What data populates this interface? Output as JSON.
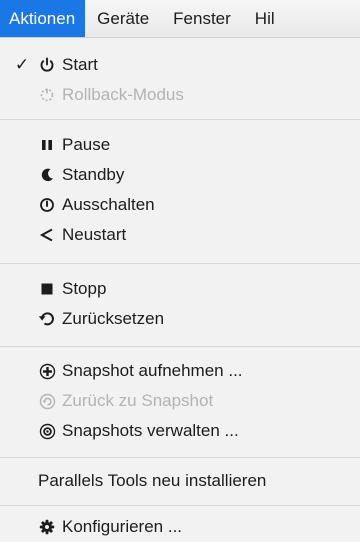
{
  "menubar": {
    "items": [
      "Aktionen",
      "Geräte",
      "Fenster",
      "Hil"
    ]
  },
  "menu": {
    "items": [
      {
        "label": "Start",
        "icon": "power-icon",
        "checked": true,
        "check_mark": "✓",
        "enabled": true
      },
      {
        "label": "Rollback-Modus",
        "icon": "rollback-icon",
        "enabled": false
      },
      {
        "label": "Pause",
        "icon": "pause-icon",
        "enabled": true
      },
      {
        "label": "Standby",
        "icon": "moon-icon",
        "enabled": true
      },
      {
        "label": "Ausschalten",
        "icon": "power-off-icon",
        "enabled": true
      },
      {
        "label": "Neustart",
        "icon": "restart-icon",
        "enabled": true
      },
      {
        "label": "Stopp",
        "icon": "stop-icon",
        "enabled": true
      },
      {
        "label": "Zurücksetzen",
        "icon": "reset-icon",
        "enabled": true
      },
      {
        "label": "Snapshot aufnehmen ...",
        "icon": "snapshot-take-icon",
        "enabled": true
      },
      {
        "label": "Zurück zu Snapshot",
        "icon": "snapshot-revert-icon",
        "enabled": false
      },
      {
        "label": "Snapshots verwalten ...",
        "icon": "snapshot-manage-icon",
        "enabled": true
      },
      {
        "label": "Parallels Tools neu installieren",
        "enabled": true
      },
      {
        "label": "Konfigurieren ...",
        "icon": "gear-icon",
        "enabled": true
      }
    ]
  },
  "colors": {
    "menubar_highlight": "#1b76e6",
    "disabled_text": "#b3b3b3"
  }
}
